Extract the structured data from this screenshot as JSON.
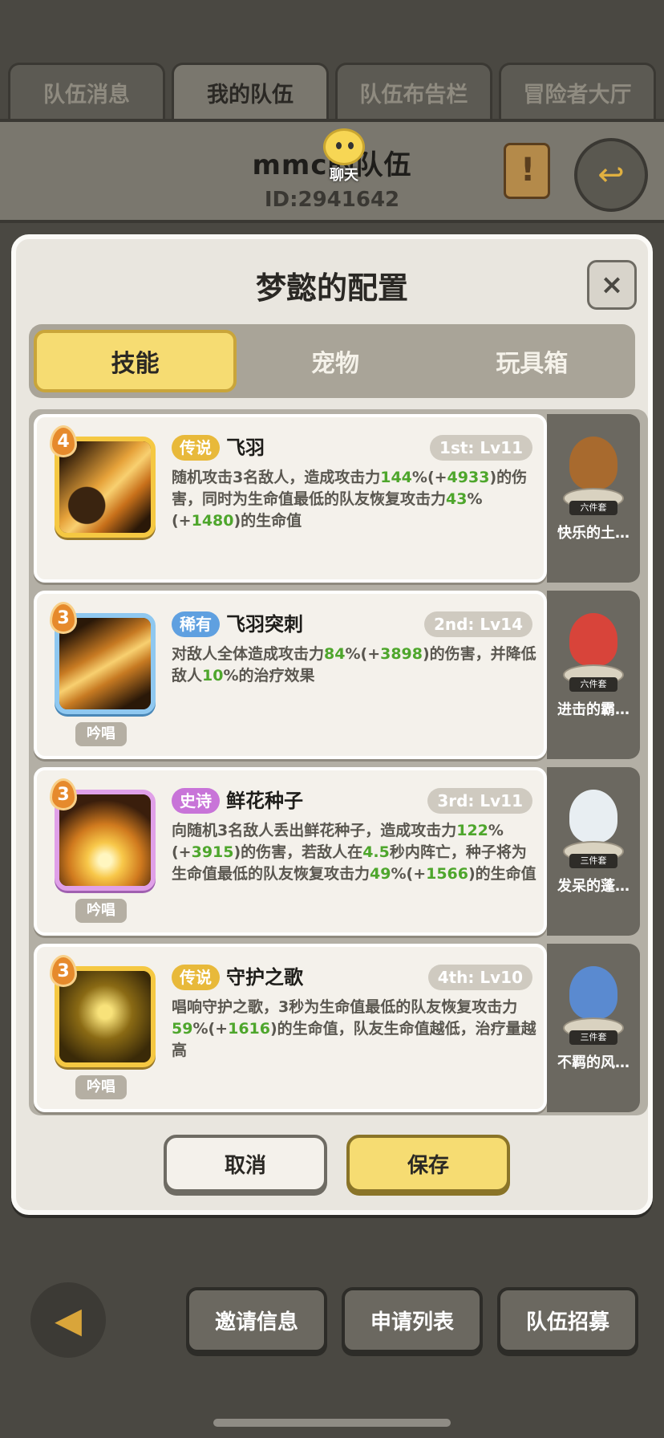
{
  "top_tabs": [
    "队伍消息",
    "我的队伍",
    "队伍布告栏",
    "冒险者大厅"
  ],
  "team": {
    "name": "mmc的队伍",
    "id": "ID:2941642",
    "chat_label": "聊天"
  },
  "modal": {
    "title": "梦懿的配置",
    "close": "×",
    "tabs": [
      "技能",
      "宠物",
      "玩具箱"
    ],
    "skills": [
      {
        "level": "4",
        "rarity": "传说",
        "name": "飞羽",
        "slot": "1st: Lv11",
        "chant": "",
        "desc": [
          [
            "随机攻击3名敌人，造成攻击力",
            ""
          ],
          [
            "144",
            "g"
          ],
          [
            "%(+",
            ""
          ],
          [
            "4933",
            "g"
          ],
          [
            ")的伤害，同时为生命值最低的队友恢复攻击力",
            ""
          ],
          [
            "43",
            "g"
          ],
          [
            "%(+",
            ""
          ],
          [
            "1480",
            "g"
          ],
          [
            ")的生命值",
            ""
          ]
        ],
        "pet_name": "快乐的土…",
        "pet_badge": "六件套"
      },
      {
        "level": "3",
        "rarity": "稀有",
        "name": "飞羽突刺",
        "slot": "2nd: Lv14",
        "chant": "吟唱",
        "desc": [
          [
            "对敌人全体造成攻击力",
            ""
          ],
          [
            "84",
            "g"
          ],
          [
            "%(+",
            ""
          ],
          [
            "3898",
            "g"
          ],
          [
            ")的伤害，并降低敌人",
            ""
          ],
          [
            "10",
            "g"
          ],
          [
            "%的治疗效果",
            ""
          ]
        ],
        "pet_name": "进击的霸…",
        "pet_badge": "六件套"
      },
      {
        "level": "3",
        "rarity": "史诗",
        "name": "鲜花种子",
        "slot": "3rd: Lv11",
        "chant": "吟唱",
        "desc": [
          [
            "向随机3名敌人丢出鲜花种子，造成攻击力",
            ""
          ],
          [
            "122",
            "g"
          ],
          [
            "%(+",
            ""
          ],
          [
            "3915",
            "g"
          ],
          [
            ")的伤害，若敌人在",
            ""
          ],
          [
            "4.5",
            "g"
          ],
          [
            "秒内阵亡，种子将为生命值最低的队友恢复攻击力",
            ""
          ],
          [
            "49",
            "g"
          ],
          [
            "%(+",
            ""
          ],
          [
            "1566",
            "g"
          ],
          [
            ")的生命值",
            ""
          ]
        ],
        "pet_name": "发呆的蓬…",
        "pet_badge": "三件套"
      },
      {
        "level": "3",
        "rarity": "传说",
        "name": "守护之歌",
        "slot": "4th: Lv10",
        "chant": "吟唱",
        "desc": [
          [
            "唱响守护之歌，3秒为生命值最低的队友恢复攻击力",
            ""
          ],
          [
            "59",
            "g"
          ],
          [
            "%(+",
            ""
          ],
          [
            "1616",
            "g"
          ],
          [
            ")的生命值，队友生命值越低，治疗量越高",
            ""
          ]
        ],
        "pet_name": "不羁的风…",
        "pet_badge": "三件套"
      }
    ],
    "cancel": "取消",
    "save": "保存"
  },
  "bottom": {
    "back_icon": "arrow-left-icon",
    "buttons": [
      "邀请信息",
      "申请列表",
      "队伍招募"
    ]
  },
  "colors": {
    "accent_yellow": "#f6dc72",
    "value_green": "#4ea62c",
    "legend": "#e8b93a",
    "rare": "#5fa0e0",
    "epic": "#c874d8"
  }
}
